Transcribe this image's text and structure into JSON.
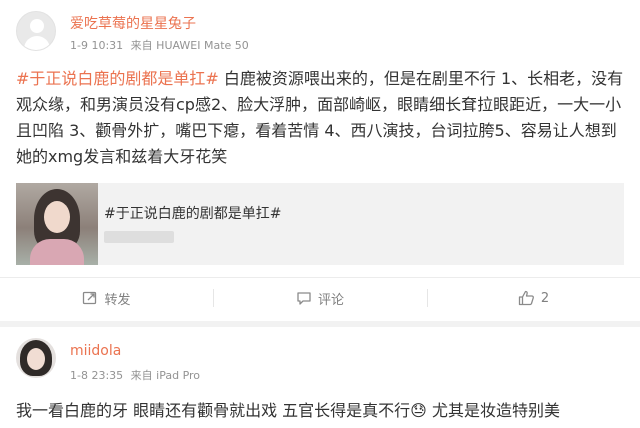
{
  "post": {
    "username": "爱吃草莓的星星兔子",
    "time": "1-9 10:31",
    "source": "来自 HUAWEI Mate 50",
    "hashtag": "#于正说白鹿的剧都是单扛#",
    "body": " 白鹿被资源喂出来的，但是在剧里不行 1、长相老，没有观众缘，和男演员没有cp感2、脸大浮肿，面部崎岖，眼睛细长耷拉眼距近，一大一小且凹陷 3、颧骨外扩，嘴巴下瘪，看着苦情 4、西八演技，台词拉胯5、容易让人想到她的xmg发言和兹着大牙花笑",
    "share_card": {
      "title": "#于正说白鹿的剧都是单扛#"
    },
    "actions": {
      "repost": "转发",
      "comment": "评论",
      "like_count": "2"
    }
  },
  "comment": {
    "username": "miidola",
    "time": "1-8 23:35",
    "source": "来自 iPad Pro",
    "body": "我一看白鹿的牙 眼睛还有颧骨就出戏 五官长得是真不行😓 尤其是妆造特别美"
  },
  "colors": {
    "accent": "#eb7350",
    "meta": "#939393",
    "background": "#f2f2f2"
  },
  "icons": {
    "repost": "repost-icon",
    "comment": "comment-icon",
    "like": "thumbs-up-icon"
  }
}
